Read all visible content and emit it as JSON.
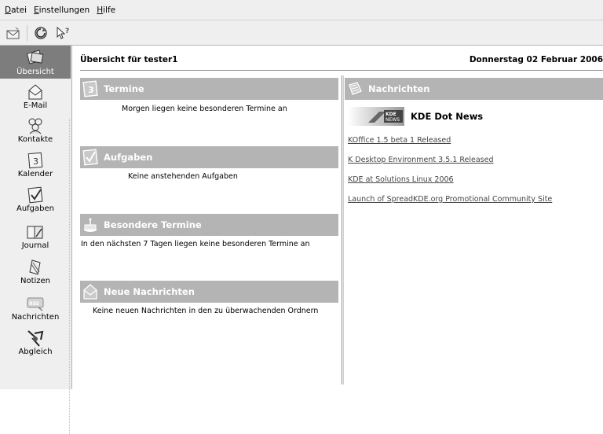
{
  "menubar": {
    "items": [
      {
        "mnemonic": "D",
        "rest": "atei"
      },
      {
        "mnemonic": "E",
        "rest": "instellungen"
      },
      {
        "mnemonic": "H",
        "rest": "ilfe"
      }
    ]
  },
  "toolbar": {
    "buttons": [
      {
        "icon": "new-mail-icon"
      },
      {
        "icon": "sync-icon"
      },
      {
        "icon": "whats-this-icon"
      }
    ]
  },
  "sidebar": {
    "items": [
      {
        "label": "Übersicht",
        "icon": "overview-icon",
        "active": true
      },
      {
        "label": "E-Mail",
        "icon": "mail-icon"
      },
      {
        "label": "Kontakte",
        "icon": "contacts-icon"
      },
      {
        "label": "Kalender",
        "icon": "calendar-icon"
      },
      {
        "label": "Aufgaben",
        "icon": "tasks-icon"
      },
      {
        "label": "Journal",
        "icon": "journal-icon"
      },
      {
        "label": "Notizen",
        "icon": "notes-icon"
      },
      {
        "label": "Nachrichten",
        "icon": "rss-icon"
      },
      {
        "label": "Abgleich",
        "icon": "sync-icon"
      }
    ]
  },
  "summary": {
    "title": "Übersicht für tester1",
    "date": "Donnerstag 02 Februar 2006"
  },
  "sections": {
    "termine": {
      "title": "Termine",
      "text": "Morgen liegen keine besonderen Termine an"
    },
    "aufgaben": {
      "title": "Aufgaben",
      "text": "Keine anstehenden Aufgaben"
    },
    "besondere": {
      "title": "Besondere Termine",
      "text": "In den nächsten 7 Tagen liegen keine besonderen Termine an"
    },
    "neue_nachrichten": {
      "title": "Neue Nachrichten",
      "text": "Keine neuen Nachrichten in den zu überwachenden Ordnern"
    },
    "nachrichten": {
      "title": "Nachrichten",
      "feed_logo_text": "KDE NEWS",
      "feed_title": "KDE Dot News",
      "links": [
        "KOffice 1.5 beta 1 Released",
        "K Desktop Environment 3.5.1 Released",
        "KDE at Solutions Linux 2006",
        "Launch of SpreadKDE.org Promotional Community Site"
      ]
    }
  }
}
